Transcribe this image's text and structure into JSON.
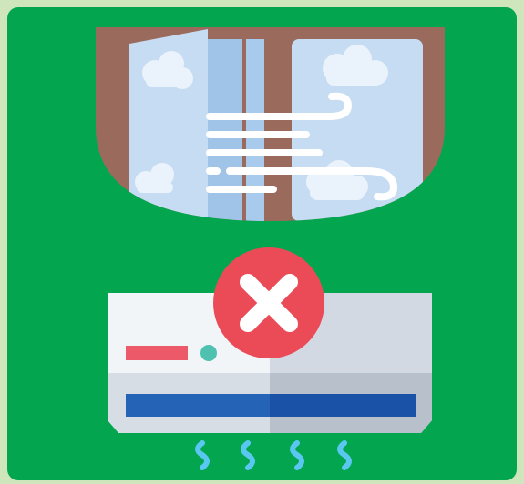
{
  "illustration": {
    "subject": "",
    "colors": {
      "frame_background": "#cfe6bd",
      "panel": "#03a64f",
      "window_frame": "#9a6b5c",
      "glass": "#c6dcf2",
      "glass_dark": "#9fc4e8",
      "cloud": "#eaf2fb",
      "wind": "#ffffff",
      "ac_body_light": "#f2f5f8",
      "ac_body_shade": "#d3d9e2",
      "ac_bottom": "#b8c0cc",
      "ac_vent": "#2563b6",
      "ac_vent_dark": "#1a52a8",
      "ac_indicator": "#ec5a6a",
      "ac_led": "#4fc1b0",
      "airflow": "#59c7f0",
      "no_badge": "#ea4b57",
      "no_cross": "#ffffff"
    },
    "icons": [
      "window-icon",
      "wind-icon",
      "air-conditioner-icon",
      "cross-icon",
      "cold-air-icon"
    ]
  }
}
